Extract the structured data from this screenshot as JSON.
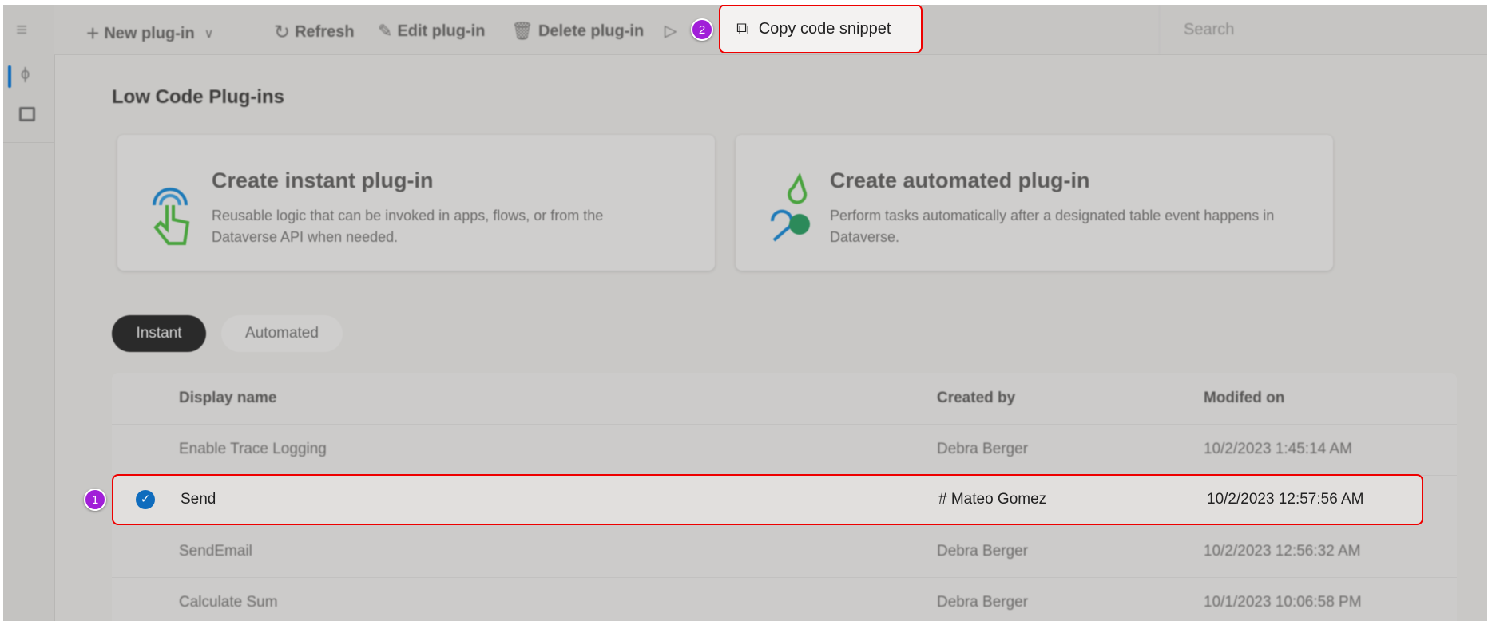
{
  "toolbar": {
    "new_plugin": "New plug-in",
    "refresh": "Refresh",
    "edit_plugin": "Edit plug-in",
    "delete_plugin": "Delete plug-in",
    "copy_code_snippet": "Copy code snippet",
    "search_placeholder": "Search"
  },
  "callouts": {
    "one": "1",
    "two": "2"
  },
  "page_title": "Low Code Plug-ins",
  "cards": [
    {
      "title": "Create instant plug-in",
      "description": "Reusable logic that can be invoked in apps, flows, or from the Dataverse API when needed."
    },
    {
      "title": "Create automated plug-in",
      "description": "Perform tasks automatically after a designated table event happens in Dataverse."
    }
  ],
  "tabs": [
    {
      "label": "Instant",
      "selected": true
    },
    {
      "label": "Automated",
      "selected": false
    }
  ],
  "table": {
    "columns": [
      "Display name",
      "Created by",
      "Modifed on"
    ],
    "rows": [
      {
        "name": "Enable Trace Logging",
        "created_by": "Debra Berger",
        "modified": "10/2/2023 1:45:14 AM"
      },
      {
        "name": "Send",
        "created_by": "# Mateo Gomez",
        "modified": "10/2/2023 12:57:56 AM",
        "selected": true
      },
      {
        "name": "SendEmail",
        "created_by": "Debra Berger",
        "modified": "10/2/2023 12:56:32 AM"
      },
      {
        "name": "Calculate Sum",
        "created_by": "Debra Berger",
        "modified": "10/1/2023 10:06:58 PM"
      }
    ]
  },
  "colors": {
    "highlight": "#e00000",
    "callout": "#a11fd8",
    "accent": "#0f6cbd"
  }
}
